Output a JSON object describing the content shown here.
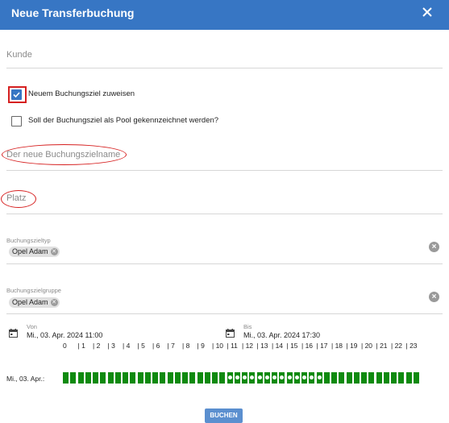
{
  "header": {
    "title": "Neue Transferbuchung",
    "close_icon": "close-icon"
  },
  "fields": {
    "kunde_placeholder": "Kunde",
    "buchungsziel_placeholder": "Der neue Buchungszielname",
    "platz_placeholder": "Platz"
  },
  "checkboxes": [
    {
      "label": "Neuem Buchungsziel zuweisen",
      "checked": true
    },
    {
      "label": "Soll der Buchungsziel als Pool gekennzeichnet werden?",
      "checked": false
    }
  ],
  "selects": [
    {
      "label": "Buchungszieltyp",
      "chip": "Opel Adam"
    },
    {
      "label": "Buchungszielgruppe",
      "chip": "Opel Adam"
    }
  ],
  "dates": {
    "from_label": "Von",
    "from_value": "Mi., 03. Apr. 2024 11:00",
    "to_label": "Bis",
    "to_value": "Mi., 03. Apr. 2024 17:30"
  },
  "schedule": {
    "day_label": "Mi., 03. Apr.:",
    "hours": [
      "0",
      "1",
      "2",
      "3",
      "4",
      "5",
      "6",
      "7",
      "8",
      "9",
      "10",
      "11",
      "12",
      "13",
      "14",
      "15",
      "16",
      "17",
      "18",
      "19",
      "20",
      "21",
      "22",
      "23"
    ],
    "selected_range": [
      "11:00",
      "17:30"
    ],
    "slot_color": "#0f8a0f"
  },
  "actions": {
    "book_label": "BUCHEN"
  },
  "colors": {
    "accent": "#3776c4",
    "annotation": "#d62020"
  }
}
